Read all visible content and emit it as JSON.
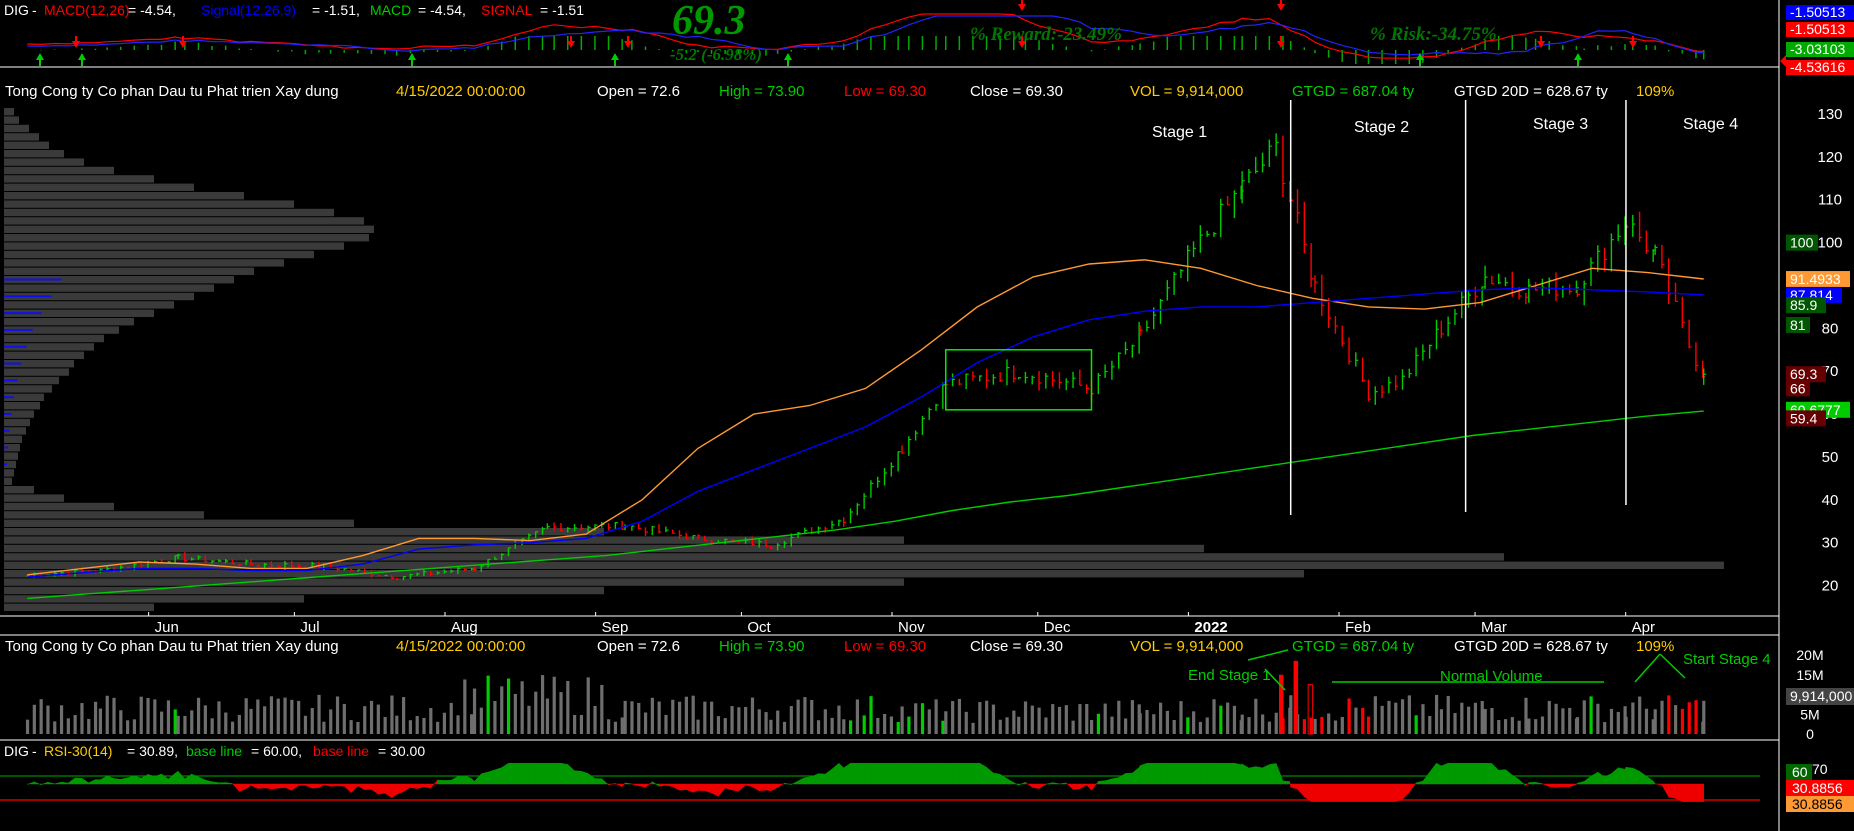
{
  "colors": {
    "bg": "#000000",
    "up": "#00cc00",
    "down": "#ff0000",
    "ema_fast": "#ff9933",
    "ema_slow": "#0000ff",
    "sma_long": "#00cc00",
    "label_yellow": "#ffcc00",
    "text": "#ffffff",
    "grid_panel": "#ffffff"
  },
  "macd_header": {
    "ticker": "DIG",
    "macd_label": "MACD(12,26)",
    "macd_value": "= -4.54,",
    "signal_label": "Signal(12,26,9)",
    "signal_value": "= -1.51,",
    "macd2_label": "MACD",
    "macd2_value": "= -4.54,",
    "signal2_label": "SIGNAL",
    "signal2_value": "= -1.51",
    "big_price": "69.3",
    "change": "-5.2 (-6.98%)",
    "reward": "% Reward:-23.49%",
    "risk": "% Risk:-34.75%"
  },
  "macd_axis_labels": [
    {
      "text": "-1.50513",
      "bg": "#0000ff"
    },
    {
      "text": "-1.50513",
      "bg": "#ff0000"
    },
    {
      "text": "-3.03103",
      "bg": "#00aa00"
    },
    {
      "text": "-4.53616",
      "bg": "#ff0000"
    }
  ],
  "info_bar": {
    "name": "Tong Cong ty Co phan Dau tu Phat trien Xay dung",
    "date": "4/15/2022 00:00:00",
    "open": "Open = 72.6",
    "high": "High = 73.90",
    "low": "Low = 69.30",
    "close": "Close = 69.30",
    "vol": "VOL = 9,914,000",
    "gtgd": "GTGD = 687.04  ty",
    "gtgd20": "GTGD 20D = 628.67  ty",
    "pct": "109%"
  },
  "stage_labels": [
    "Stage 1",
    "Stage 2",
    "Stage 3",
    "Stage 4"
  ],
  "price_axis_ticks": [
    "130",
    "120",
    "110",
    "100",
    "90",
    "80",
    "70",
    "60",
    "50",
    "40",
    "30",
    "20"
  ],
  "price_tags": [
    {
      "text": "100",
      "bg": "#005500",
      "value": 100
    },
    {
      "text": "91.4933",
      "bg": "#ff9933",
      "value": 91.5
    },
    {
      "text": "87.814",
      "bg": "#0000ff",
      "value": 87.8
    },
    {
      "text": "85.9",
      "bg": "#005500",
      "value": 85.4
    },
    {
      "text": "81",
      "bg": "#005500",
      "value": 80.8
    },
    {
      "text": "69.3",
      "bg": "#660000",
      "value": 69.3
    },
    {
      "text": "66",
      "bg": "#660000",
      "value": 66
    },
    {
      "text": "60.6777",
      "bg": "#00cc00",
      "value": 61
    },
    {
      "text": "59.4",
      "bg": "#660000",
      "value": 59
    }
  ],
  "month_labels": [
    "Jun",
    "Jul",
    "Aug",
    "Sep",
    "Oct",
    "Nov",
    "Dec",
    "2022",
    "Feb",
    "Mar",
    "Apr"
  ],
  "volume_annotations": {
    "end_stage1": "End Stage 1",
    "normal_volume": "Normal Volume",
    "start_stage4": "Start Stage 4"
  },
  "volume_axis": [
    "20M",
    "15M",
    "10M",
    "5M",
    "0"
  ],
  "volume_tag": "9,914,000",
  "rsi_header": {
    "ticker": "DIG",
    "label": "RSI-30(14)",
    "value": "= 30.89,",
    "base1_label": "base line",
    "base1_value": "= 60.00,",
    "base2_label": "base line",
    "base2_value": "= 30.00"
  },
  "rsi_axis": [
    "70"
  ],
  "rsi_tags": [
    {
      "text": "60",
      "bg": "#006600"
    },
    {
      "text": "30.8856",
      "bg": "#ff0000"
    },
    {
      "text": "30.8856",
      "bg": "#ff9933"
    }
  ],
  "chart_data": {
    "type": "candlestick",
    "ticker": "DIG",
    "ylim": [
      15,
      130
    ],
    "y_ticks": [
      20,
      30,
      40,
      50,
      60,
      70,
      80,
      90,
      100,
      110,
      120,
      130
    ],
    "close_series": [
      {
        "x": "2021-05-05",
        "y": 22.5
      },
      {
        "x": "2021-05-20",
        "y": 23.5
      },
      {
        "x": "2021-06-05",
        "y": 26.5
      },
      {
        "x": "2021-06-20",
        "y": 25.0
      },
      {
        "x": "2021-07-05",
        "y": 24.5
      },
      {
        "x": "2021-07-20",
        "y": 22.0
      },
      {
        "x": "2021-08-05",
        "y": 24.0
      },
      {
        "x": "2021-08-20",
        "y": 33.5
      },
      {
        "x": "2021-09-05",
        "y": 34.0
      },
      {
        "x": "2021-09-20",
        "y": 31.0
      },
      {
        "x": "2021-10-05",
        "y": 29.5
      },
      {
        "x": "2021-10-20",
        "y": 35.5
      },
      {
        "x": "2021-11-01",
        "y": 52.0
      },
      {
        "x": "2021-11-10",
        "y": 67.0
      },
      {
        "x": "2021-11-25",
        "y": 70.0
      },
      {
        "x": "2021-12-10",
        "y": 66.0
      },
      {
        "x": "2021-12-20",
        "y": 78.0
      },
      {
        "x": "2021-12-31",
        "y": 98.0
      },
      {
        "x": "2022-01-10",
        "y": 113.0
      },
      {
        "x": "2022-01-17",
        "y": 122.0
      },
      {
        "x": "2022-01-20",
        "y": 110.0
      },
      {
        "x": "2022-01-25",
        "y": 90.0
      },
      {
        "x": "2022-02-05",
        "y": 65.0
      },
      {
        "x": "2022-02-12",
        "y": 68.0
      },
      {
        "x": "2022-02-20",
        "y": 80.0
      },
      {
        "x": "2022-03-01",
        "y": 92.0
      },
      {
        "x": "2022-03-10",
        "y": 89.0
      },
      {
        "x": "2022-03-20",
        "y": 90.0
      },
      {
        "x": "2022-03-30",
        "y": 105.0
      },
      {
        "x": "2022-04-05",
        "y": 97.0
      },
      {
        "x": "2022-04-12",
        "y": 76.0
      },
      {
        "x": "2022-04-15",
        "y": 69.3
      }
    ],
    "ema_fast": [
      22.5,
      24.0,
      25.5,
      25.0,
      24.0,
      24.0,
      27.0,
      31.0,
      31.0,
      30.5,
      32.0,
      40.0,
      52.0,
      60.0,
      62.0,
      66.0,
      75.0,
      85.0,
      92.0,
      95.0,
      96.0,
      94.0,
      90.0,
      87.0,
      85.0,
      84.5,
      86.0,
      90.0,
      94.0,
      93.0,
      91.5
    ],
    "ema_slow": [
      22.0,
      23.0,
      24.0,
      24.0,
      23.5,
      23.5,
      25.0,
      28.5,
      29.5,
      30.0,
      31.0,
      35.0,
      42.0,
      47.0,
      52.0,
      57.0,
      64.0,
      72.0,
      78.0,
      82.0,
      84.0,
      85.0,
      85.0,
      86.0,
      87.0,
      88.0,
      89.0,
      89.5,
      89.0,
      88.5,
      87.8
    ],
    "sma_long": [
      17.0,
      18.0,
      19.0,
      20.0,
      21.0,
      22.0,
      23.0,
      24.0,
      25.0,
      26.0,
      27.0,
      28.5,
      30.0,
      31.5,
      33.0,
      35.0,
      37.5,
      39.5,
      41.0,
      43.0,
      45.0,
      47.0,
      49.0,
      51.0,
      53.0,
      55.0,
      56.5,
      58.0,
      59.5,
      60.7
    ],
    "box": {
      "x0": "2021-11-10",
      "x1": "2021-12-10",
      "y0": 61,
      "y1": 75
    },
    "stage_dividers": [
      "2022-01-20",
      "2022-02-25",
      "2022-03-30"
    ],
    "last_bar": {
      "date": "4/15/2022",
      "open": 72.6,
      "high": 73.9,
      "low": 69.3,
      "close": 69.3,
      "volume": 9914000
    },
    "volume_ylim": [
      0,
      20000000
    ],
    "rsi_ylim": [
      20,
      80
    ],
    "rsi_baselines": [
      60,
      30
    ],
    "rsi_last": 30.89,
    "macd_last": -4.54,
    "signal_last": -1.51
  }
}
